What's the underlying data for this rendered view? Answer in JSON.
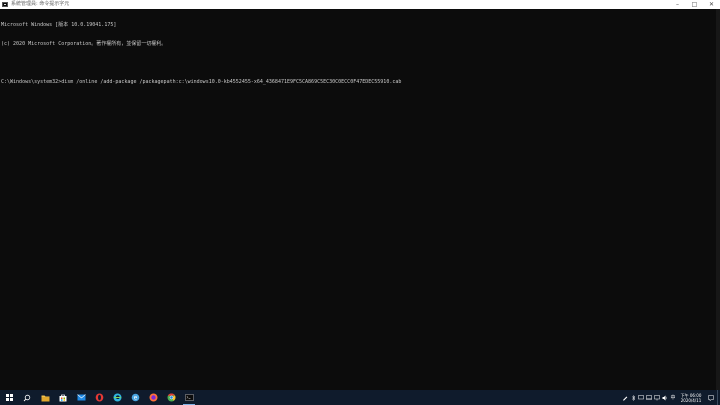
{
  "window": {
    "title": "系統管理員: 命令提示字元",
    "controls": {
      "minimize": "–",
      "maximize": "□",
      "close": "✕"
    }
  },
  "console": {
    "lines": [
      "Microsoft Windows [版本 10.0.19041.175]",
      "(c) 2020 Microsoft Corporation。著作權所有，並保留一切權利。"
    ],
    "command_line": "C:\\Windows\\system32>dism /online /add-package /packagepath:c:\\windows10.0-kb4552455-x64_4368471E9FC5CA869C5EC30C0ECC0F47EDEC55910.cab"
  },
  "taskbar": {
    "apps": [
      {
        "name": "start-button",
        "icon": "windows-logo"
      },
      {
        "name": "search",
        "icon": "search-icon"
      },
      {
        "name": "file-explorer",
        "icon": "folder-icon",
        "color": "#f2c14e"
      },
      {
        "name": "store",
        "icon": "store-icon",
        "color": "#ffffff"
      },
      {
        "name": "mail",
        "icon": "mail-icon",
        "color": "#1e88e5"
      },
      {
        "name": "opera",
        "icon": "opera-icon",
        "color": "#e53935"
      },
      {
        "name": "edge",
        "icon": "edge-icon",
        "color": "#2fb6e0"
      },
      {
        "name": "ie",
        "icon": "ie-icon",
        "color": "#4aa3df"
      },
      {
        "name": "firefox",
        "icon": "firefox-icon",
        "color": "#ff7139"
      },
      {
        "name": "chrome",
        "icon": "chrome-icon",
        "color": "#4caf50"
      },
      {
        "name": "cmd",
        "icon": "cmd-icon",
        "color": "#cccccc"
      }
    ],
    "clock": {
      "time": "下午 06:00",
      "date": "2020/4/11"
    },
    "input_indicator": "中"
  }
}
